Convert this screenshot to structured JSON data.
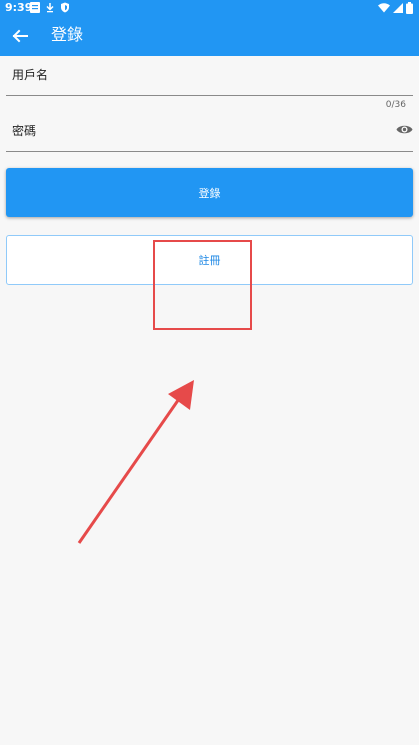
{
  "status_bar": {
    "time": "9:39",
    "notification_icons": [
      "message-icon",
      "download-icon",
      "shield-icon"
    ],
    "system_icons": [
      "wifi-icon",
      "signal-icon",
      "battery-icon"
    ]
  },
  "app_bar": {
    "title": "登錄",
    "back_icon": "arrow-back-icon",
    "color": "#2196f3"
  },
  "form": {
    "username_label": "用戶名",
    "username_counter": "0/36",
    "password_label": "密碼",
    "password_toggle_icon": "eye-icon"
  },
  "buttons": {
    "login_label": "登錄",
    "register_label": "註冊"
  },
  "annotation": {
    "highlight_color": "#e64a4a"
  }
}
